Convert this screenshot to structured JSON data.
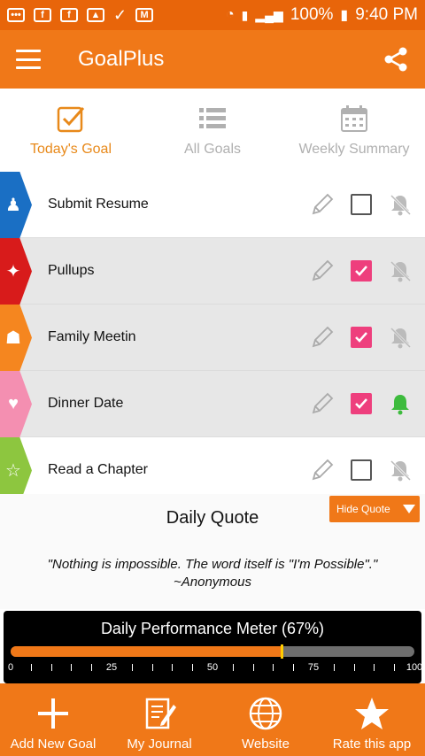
{
  "status_bar": {
    "left_icons": [
      "chat-icon",
      "facebook-icon",
      "facebook-icon",
      "image-icon",
      "check-icon",
      "gmail-icon"
    ],
    "battery": "100%",
    "time": "9:40 PM"
  },
  "app_bar": {
    "title": "GoalPlus"
  },
  "tabs": [
    {
      "label": "Today's Goal",
      "icon": "checkbox-icon",
      "active": true
    },
    {
      "label": "All Goals",
      "icon": "list-icon",
      "active": false
    },
    {
      "label": "Weekly Summary",
      "icon": "calendar-icon",
      "active": false
    }
  ],
  "goals": [
    {
      "name": "Submit Resume",
      "color": "#1a6fc4",
      "icon": "person-icon",
      "checked": false,
      "bell": "off"
    },
    {
      "name": "Pullups",
      "color": "#d81b1b",
      "icon": "exercise-icon",
      "checked": true,
      "bell": "off"
    },
    {
      "name": "Family Meetin",
      "color": "#f5861f",
      "icon": "family-icon",
      "checked": true,
      "bell": "off"
    },
    {
      "name": "Dinner Date",
      "color": "#f48fb1",
      "icon": "glasses-icon",
      "checked": true,
      "bell": "on"
    },
    {
      "name": "Read a Chapter",
      "color": "#8dc63f",
      "icon": "star-icon",
      "checked": false,
      "bell": "off"
    }
  ],
  "quote": {
    "title": "Daily Quote",
    "hide_label": "Hide Quote",
    "text": "\"Nothing is impossible. The word itself is \"I'm Possible\".\"",
    "author": "~Anonymous"
  },
  "meter": {
    "title": "Daily Performance Meter",
    "value_label": "(67%)",
    "value": 0.67,
    "tick_labels": [
      "0",
      "25",
      "50",
      "75",
      "100"
    ]
  },
  "bottom_bar": [
    {
      "label": "Add New Goal",
      "icon": "plus-icon"
    },
    {
      "label": "My Journal",
      "icon": "journal-icon"
    },
    {
      "label": "Website",
      "icon": "globe-icon"
    },
    {
      "label": "Rate this app",
      "icon": "star-icon"
    }
  ],
  "colors": {
    "primary": "#f07818",
    "accent_pink": "#ee3f7d",
    "bell_on": "#3dbb3d"
  }
}
